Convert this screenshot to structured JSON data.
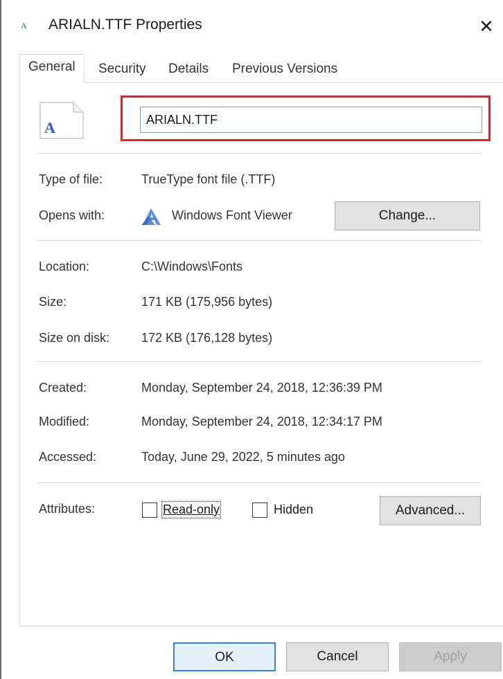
{
  "window": {
    "title": "ARIALN.TTF Properties",
    "close_label": "✕",
    "title_icon_glyph": "A"
  },
  "tabs": [
    {
      "label": "General",
      "active": true
    },
    {
      "label": "Security",
      "active": false
    },
    {
      "label": "Details",
      "active": false
    },
    {
      "label": "Previous Versions",
      "active": false
    }
  ],
  "file": {
    "icon_glyph": "A",
    "name": "ARIALN.TTF"
  },
  "info": {
    "type_label": "Type of file:",
    "type_value": "TrueType font file (.TTF)",
    "opens_label": "Opens with:",
    "opens_value": "Windows Font Viewer",
    "change_label": "Change...",
    "location_label": "Location:",
    "location_value": "C:\\Windows\\Fonts",
    "size_label": "Size:",
    "size_value": "171 KB (175,956 bytes)",
    "size_disk_label": "Size on disk:",
    "size_disk_value": "172 KB (176,128 bytes)",
    "created_label": "Created:",
    "created_value": "Monday, September 24, 2018, 12:36:39 PM",
    "modified_label": "Modified:",
    "modified_value": "Monday, September 24, 2018, 12:34:17 PM",
    "accessed_label": "Accessed:",
    "accessed_value": "Today, June 29, 2022, 5 minutes ago"
  },
  "attributes": {
    "label": "Attributes:",
    "readonly_label": "Read-only",
    "readonly_checked": false,
    "hidden_label": "Hidden",
    "hidden_checked": false,
    "advanced_label": "Advanced..."
  },
  "footer": {
    "ok_label": "OK",
    "cancel_label": "Cancel",
    "apply_label": "Apply"
  },
  "colors": {
    "highlight_outline": "#d6262e",
    "field_border": "#7a9cc6",
    "button_face": "#e1e1e1",
    "disabled_text": "#a0a0a0"
  }
}
